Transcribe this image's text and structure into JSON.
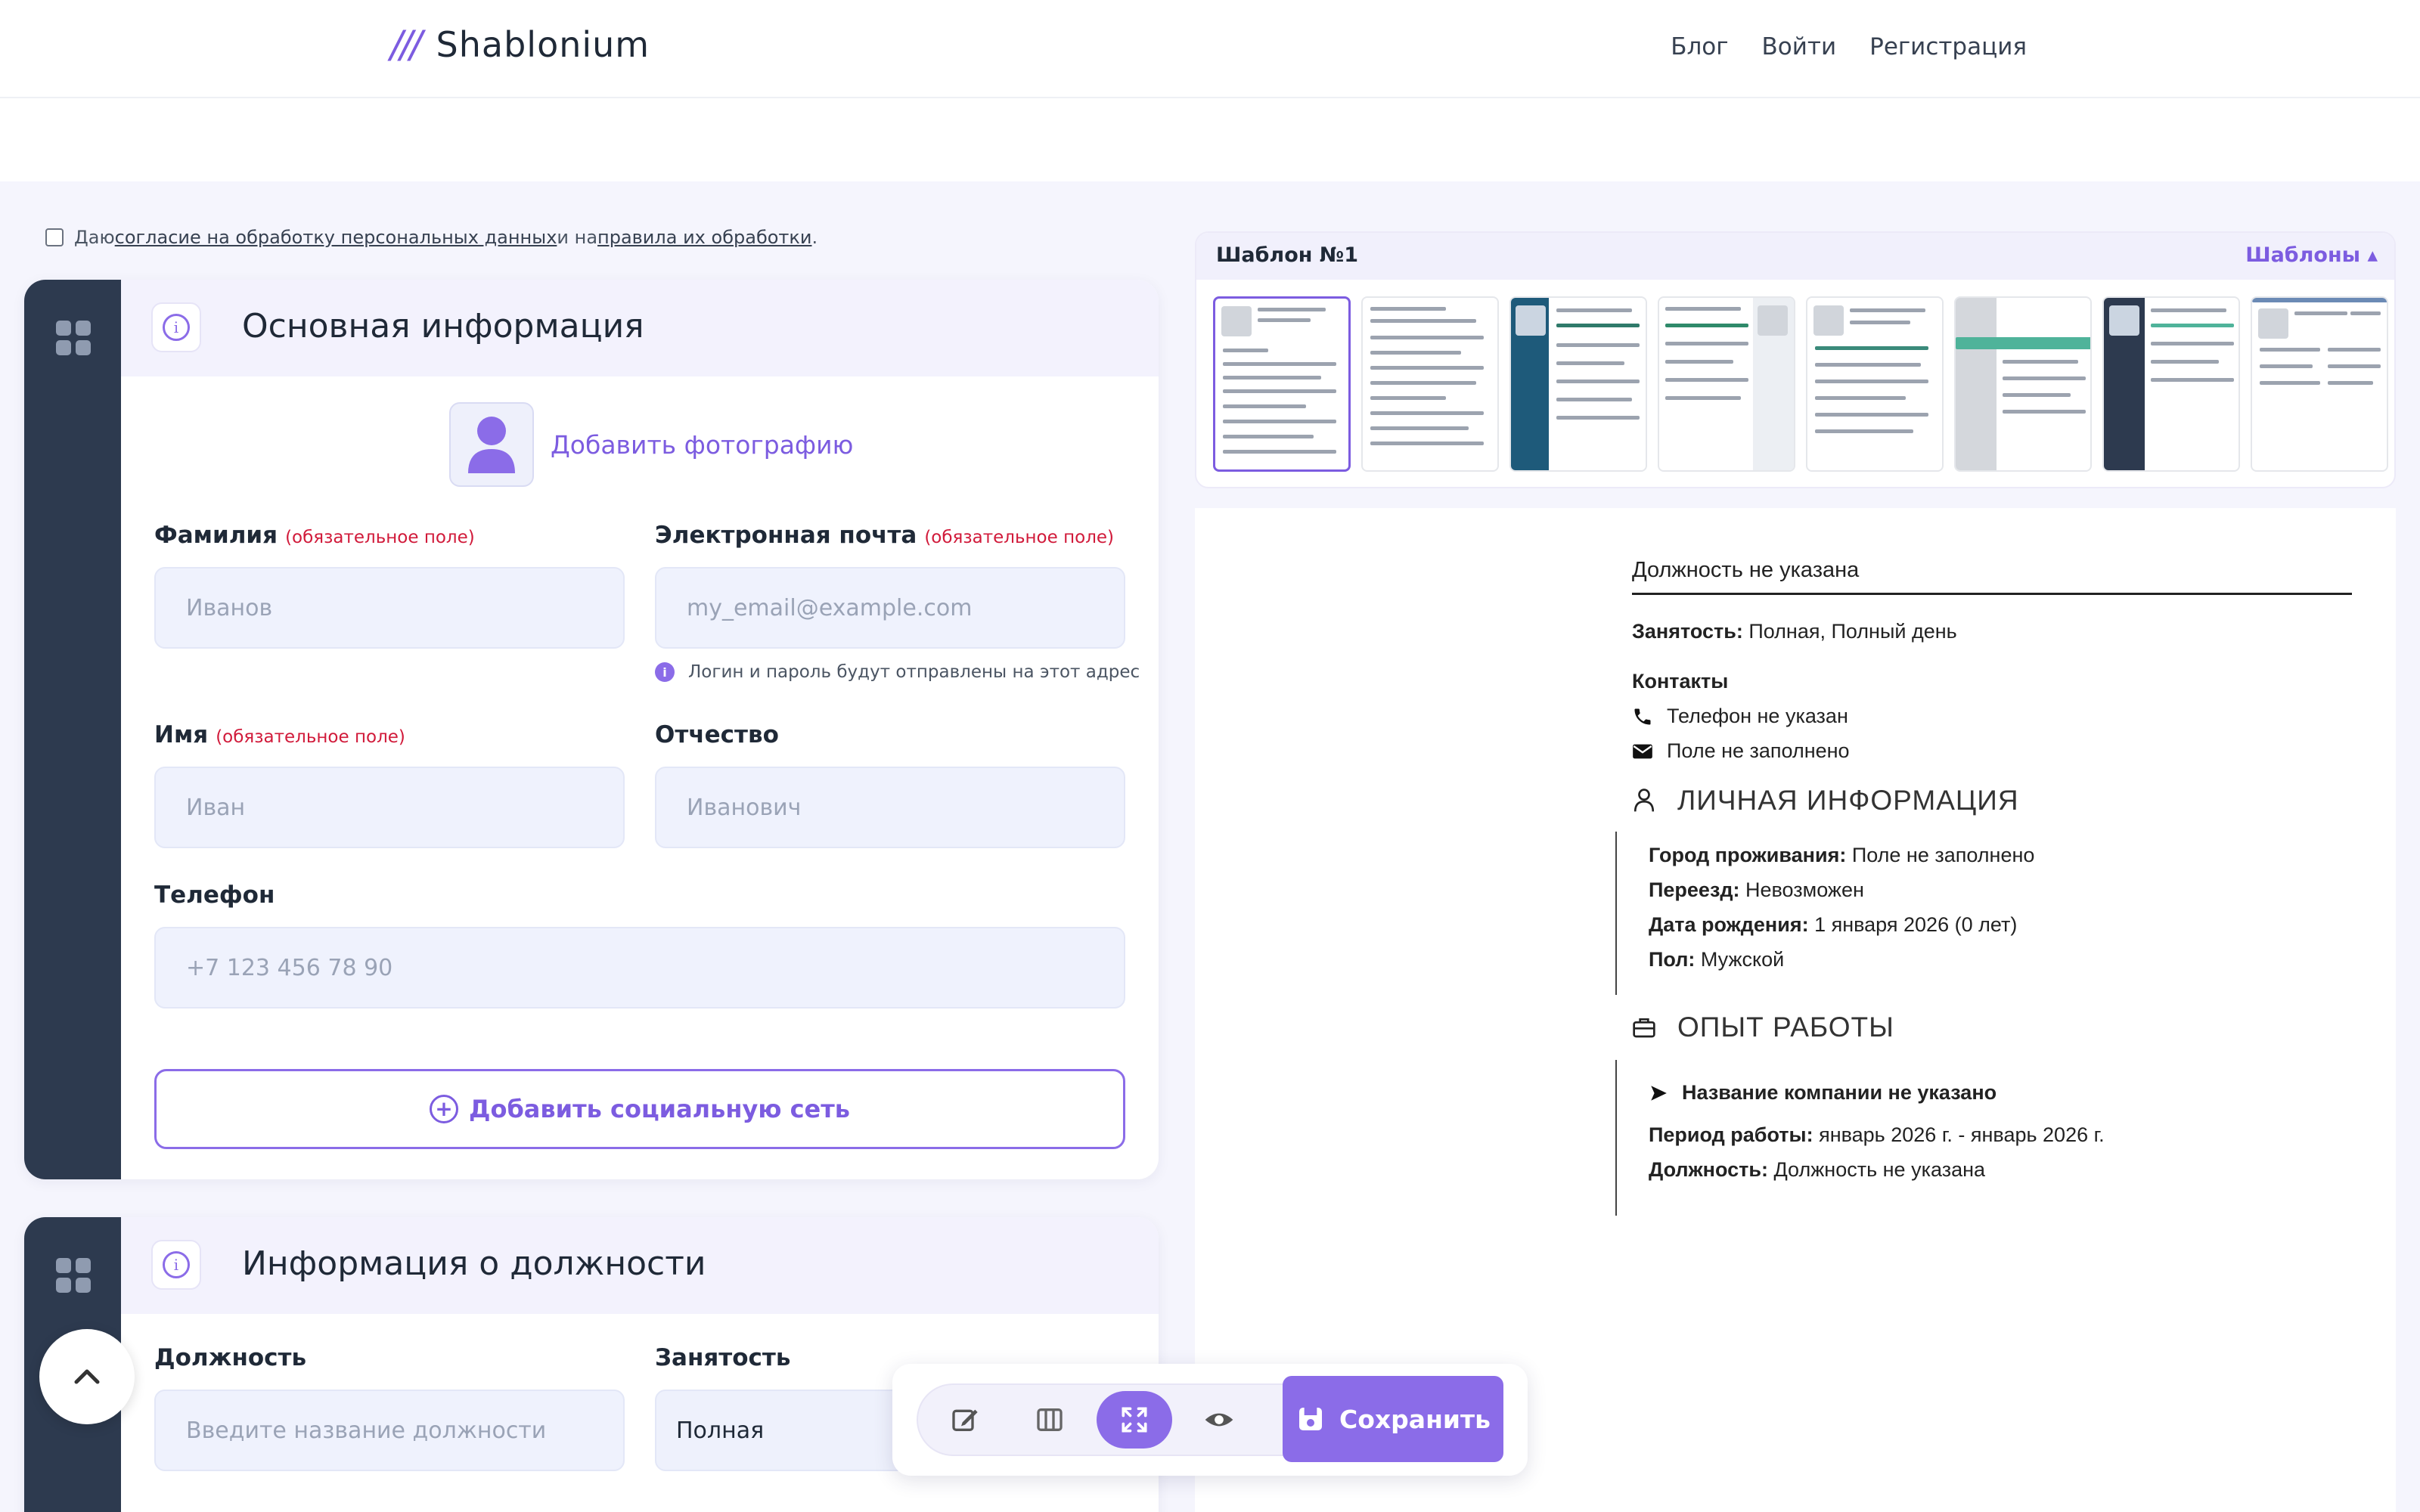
{
  "header": {
    "logo_mark": "///",
    "logo_text": "Shablonium",
    "nav": [
      "Блог",
      "Войти",
      "Регистрация"
    ]
  },
  "consent": {
    "prefix": "Даю ",
    "link1": "согласие на обработку персональных данных",
    "middle": " и на ",
    "link2": "правила их обработки",
    "suffix": "."
  },
  "basic_info": {
    "title": "Основная информация",
    "photo_label": "Добавить фотографию",
    "required_note": "(обязательное поле)",
    "fields": {
      "last_name": {
        "label": "Фамилия",
        "placeholder": "Иванов"
      },
      "email": {
        "label": "Электронная почта",
        "placeholder": "my_email@example.com",
        "hint": "Логин и пароль будут отправлены на этот адрес"
      },
      "first_name": {
        "label": "Имя",
        "placeholder": "Иван"
      },
      "patronymic": {
        "label": "Отчество",
        "placeholder": "Иванович"
      },
      "phone": {
        "label": "Телефон",
        "placeholder": "+7 123 456 78 90"
      }
    },
    "add_social": "Добавить социальную сеть"
  },
  "position_info": {
    "title": "Информация о должности",
    "position": {
      "label": "Должность",
      "placeholder": "Введите название должности"
    },
    "employment": {
      "label": "Занятость",
      "value": "Полная"
    }
  },
  "templates": {
    "current": "Шаблон №1",
    "toggle": "Шаблоны ▴"
  },
  "preview": {
    "position": "Должность не указана",
    "employment_label": "Занятость:",
    "employment_value": " Полная, Полный день",
    "contacts_title": "Контакты",
    "phone": "Телефон не указан",
    "email": "Поле не заполнено",
    "personal_title": "ЛИЧНАЯ ИНФОРМАЦИЯ",
    "city_label": "Город проживания:",
    "city_value": " Поле не заполнено",
    "relocation_label": "Переезд:",
    "relocation_value": " Невозможен",
    "birth_label": "Дата рождения:",
    "birth_value": " 1 января 2026 (0 лет)",
    "gender_label": "Пол:",
    "gender_value": " Мужской",
    "experience_title": "ОПЫТ РАБОТЫ",
    "company": "Название компании не указано",
    "period_label": "Период работы:",
    "period_value": " январь 2026 г. - январь 2026 г.",
    "job_label": "Должность:",
    "job_value": " Должность не указана"
  },
  "toolbar": {
    "save_label": "Сохранить"
  },
  "colors": {
    "accent": "#8b6ce8",
    "rail": "#2d3a4f",
    "required": "#d11a3a"
  }
}
